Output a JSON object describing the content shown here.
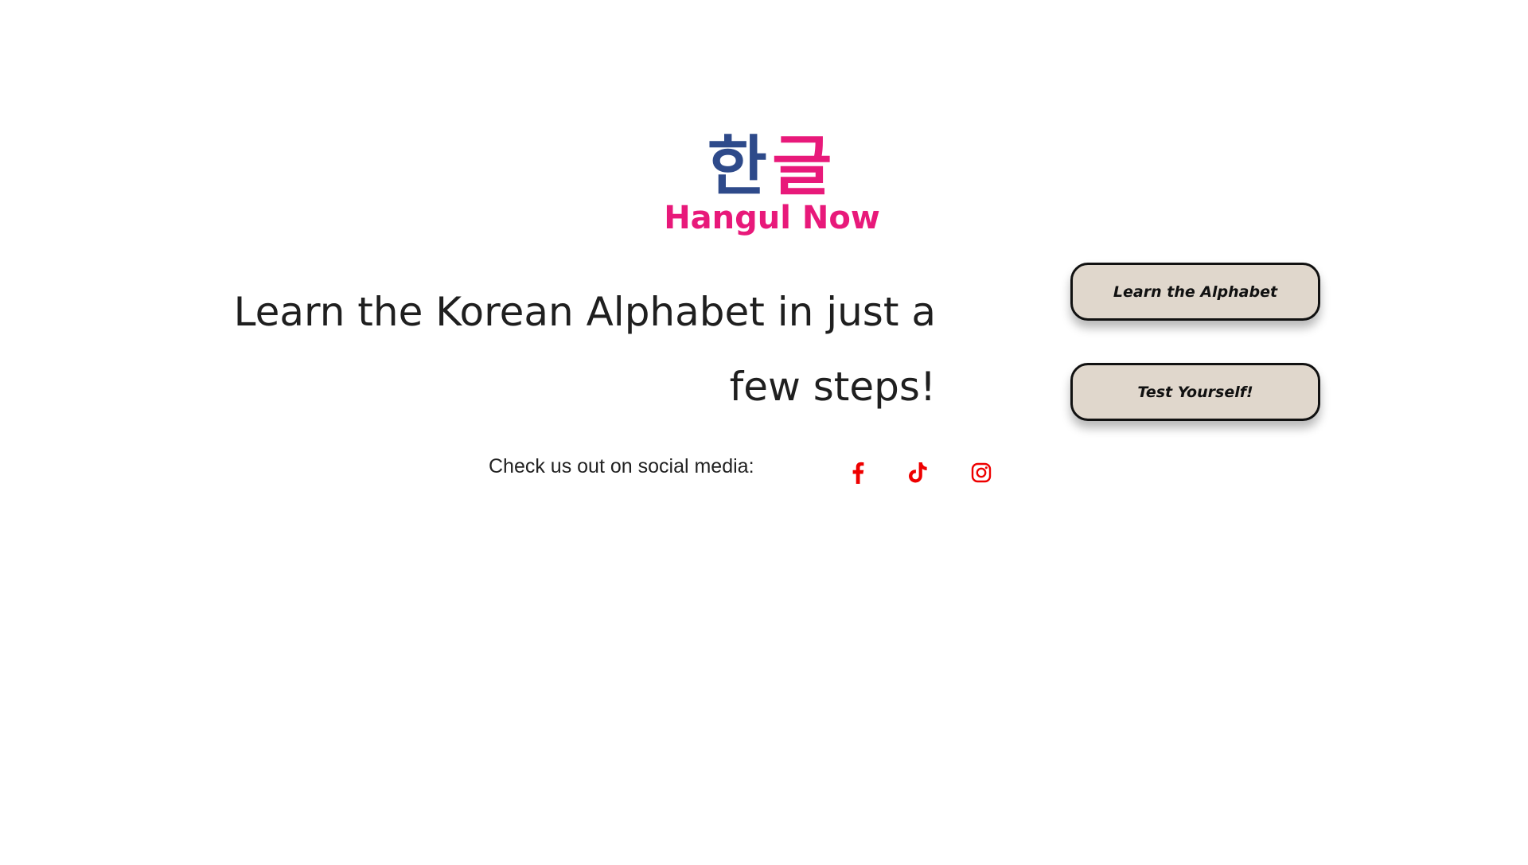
{
  "logo": {
    "korean_first": "한",
    "korean_second": "글",
    "name": "Hangul Now"
  },
  "hero": {
    "headline": "Learn the Korean Alphabet in just a few steps!"
  },
  "actions": {
    "learn_label": "Learn the Alphabet",
    "test_label": "Test Yourself!"
  },
  "social": {
    "label": "Check us out on social media:",
    "icons": [
      "facebook-icon",
      "tiktok-icon",
      "instagram-icon"
    ]
  },
  "colors": {
    "brand_pink": "#e8197a",
    "brand_blue": "#2e4a8a",
    "button_bg": "#e0d7cc",
    "social_icon": "#ee0000"
  }
}
